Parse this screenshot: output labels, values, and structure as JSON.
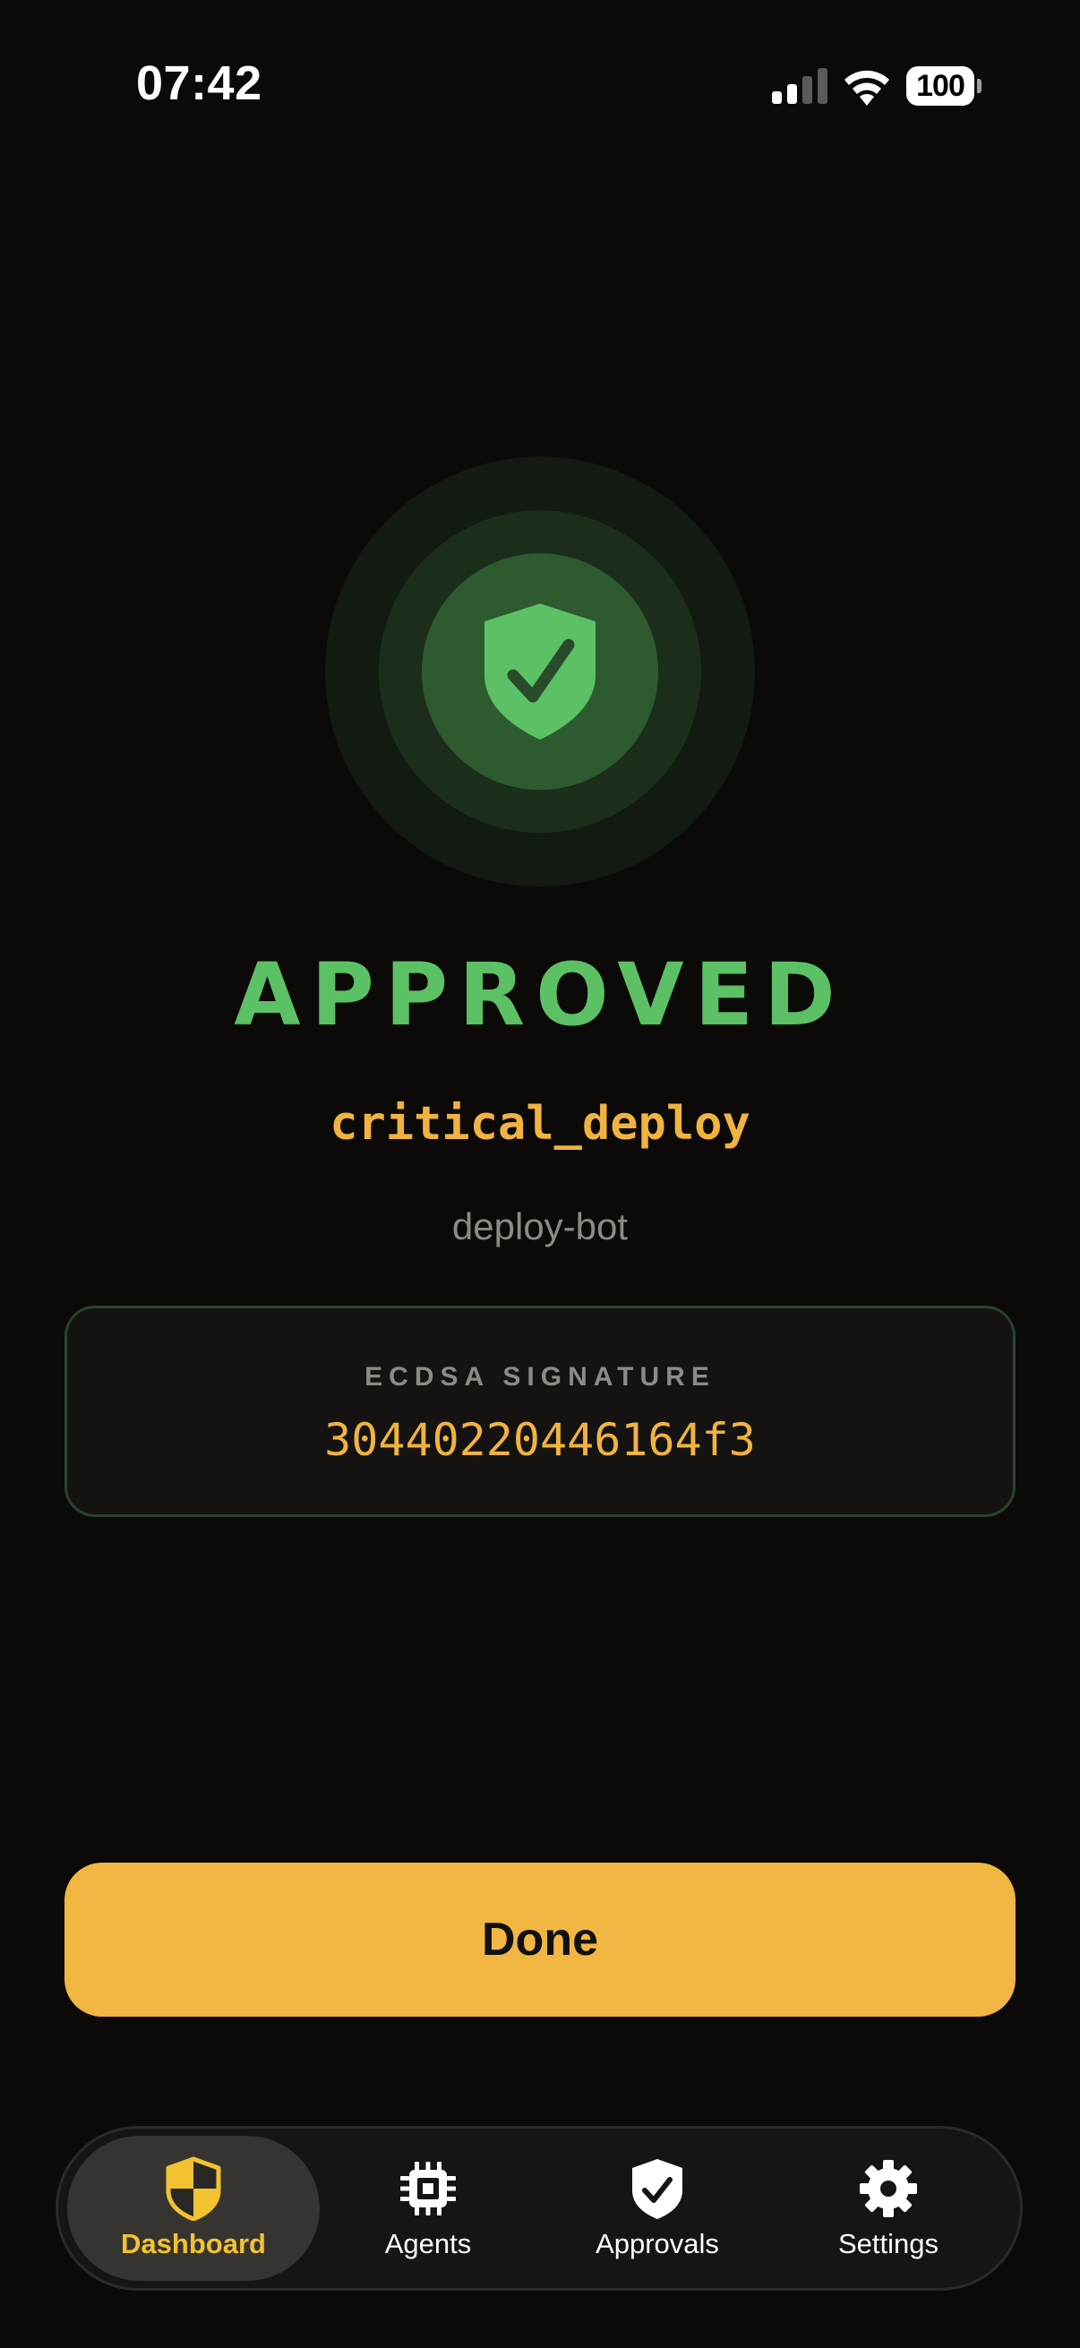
{
  "status_bar": {
    "time": "07:42",
    "battery": "100",
    "icons": [
      "signal-icon",
      "wifi-icon",
      "battery-icon"
    ]
  },
  "result": {
    "icon": "shield-check-icon",
    "title": "APPROVED",
    "action": "critical_deploy",
    "agent": "deploy-bot"
  },
  "signature": {
    "label": "ECDSA SIGNATURE",
    "value": "30440220446164f3"
  },
  "done_button": {
    "label": "Done"
  },
  "tab_bar": {
    "active": "Dashboard",
    "tabs": [
      {
        "label": "Dashboard",
        "icon": "shield-half-icon"
      },
      {
        "label": "Agents",
        "icon": "chip-icon"
      },
      {
        "label": "Approvals",
        "icon": "shield-check-icon"
      },
      {
        "label": "Settings",
        "icon": "gear-icon"
      }
    ]
  },
  "colors": {
    "background": "#0c0a08",
    "success": "#5cc065",
    "accent": "#f2b742",
    "muted": "#8e8a82"
  }
}
